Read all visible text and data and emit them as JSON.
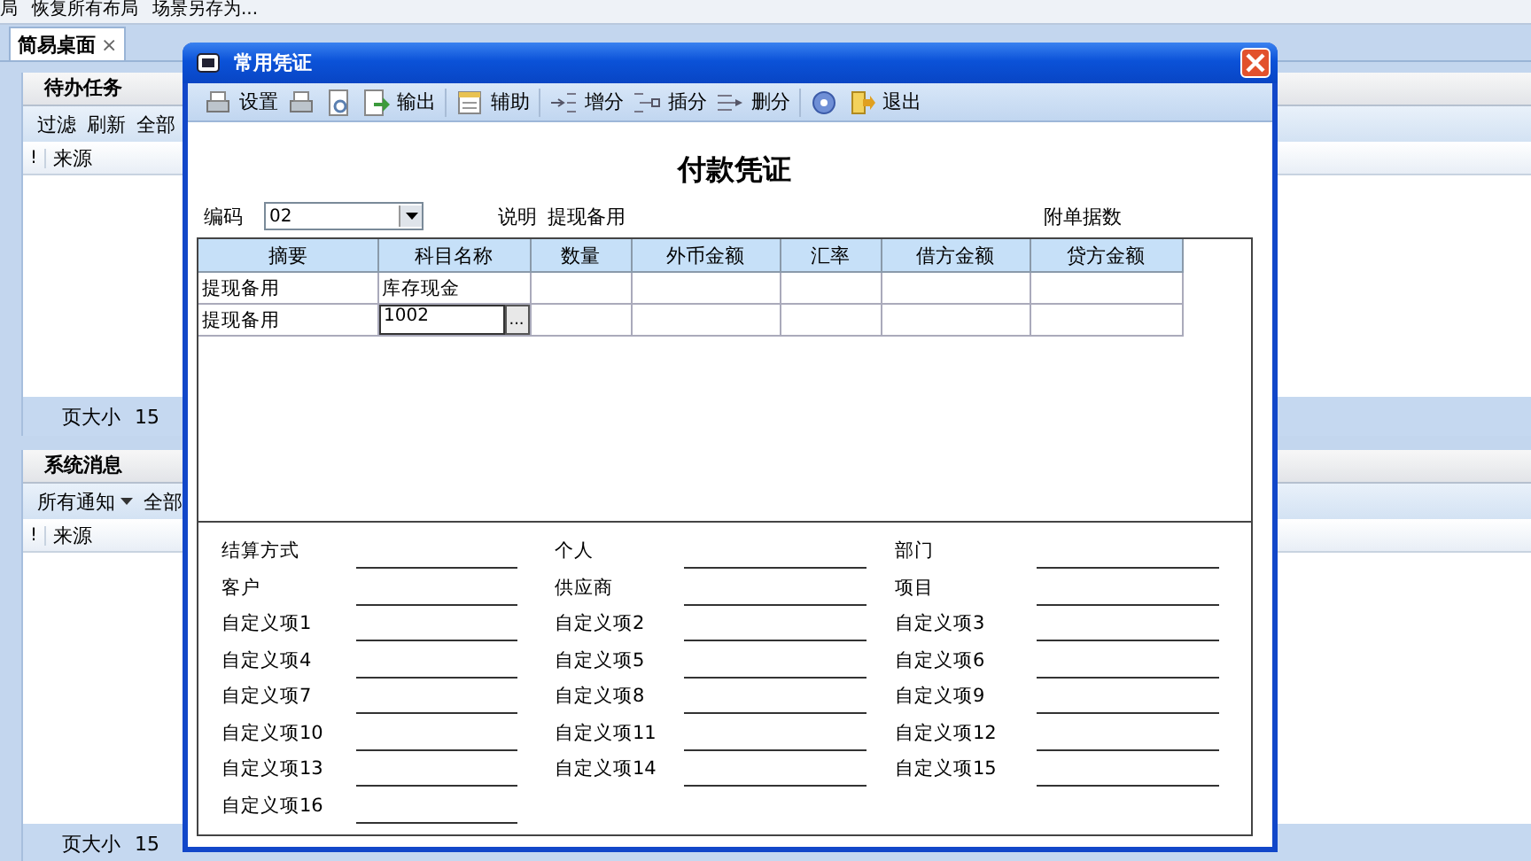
{
  "menu_bar": {
    "items": [
      "局",
      "恢复所有布局",
      "场景另存为..."
    ]
  },
  "tabs": [
    {
      "label": "简易桌面",
      "close": "×",
      "selected": true
    }
  ],
  "panels": [
    {
      "title": "待办任务",
      "toolbar": [
        {
          "label": "过滤",
          "kind": "button"
        },
        {
          "label": "刷新",
          "kind": "button"
        },
        {
          "label": "全部",
          "kind": "button"
        }
      ],
      "columns": [
        "!",
        "来源"
      ],
      "footer": {
        "label": "页大小",
        "value": "15"
      }
    },
    {
      "title": "系统消息",
      "toolbar": [
        {
          "label": "所有通知",
          "kind": "dropdown"
        },
        {
          "label": "全部",
          "kind": "button"
        }
      ],
      "columns": [
        "!",
        "来源"
      ],
      "footer": {
        "label": "页大小",
        "value": "15"
      }
    }
  ],
  "dialog": {
    "title": "常用凭证",
    "toolbar": [
      [
        {
          "kind": "printer",
          "label": "设置"
        },
        {
          "kind": "printer"
        },
        {
          "kind": "preview"
        },
        {
          "kind": "export",
          "label": "输出"
        }
      ],
      [
        {
          "kind": "notepad",
          "label": "辅助"
        }
      ],
      [
        {
          "kind": "add-split",
          "label": "增分"
        },
        {
          "kind": "insert-split",
          "label": "插分"
        },
        {
          "kind": "delete-split",
          "label": "删分"
        }
      ],
      [
        {
          "kind": "help"
        },
        {
          "kind": "exit",
          "label": "退出"
        }
      ]
    ],
    "heading": "付款凭证",
    "code": {
      "label": "编码",
      "value": "02"
    },
    "note": {
      "label": "说明",
      "value": "提现备用"
    },
    "attachments": {
      "label": "附单据数"
    },
    "table": {
      "columns": [
        "摘要",
        "科目名称",
        "数量",
        "外币金额",
        "汇率",
        "借方金额",
        "贷方金额"
      ],
      "rows": [
        {
          "summary": "提现备用",
          "account": "库存现金",
          "editing": false
        },
        {
          "summary": "提现备用",
          "account": "1002",
          "editing": true,
          "picker": "..."
        }
      ]
    },
    "fields": [
      [
        "结算方式",
        "客户",
        "自定义项1",
        "自定义项4",
        "自定义项7",
        "自定义项10",
        "自定义项13",
        "自定义项16"
      ],
      [
        "个人",
        "供应商",
        "自定义项2",
        "自定义项5",
        "自定义项8",
        "自定义项11",
        "自定义项14"
      ],
      [
        "部门",
        "项目",
        "自定义项3",
        "自定义项6",
        "自定义项9",
        "自定义项12",
        "自定义项15"
      ]
    ]
  }
}
